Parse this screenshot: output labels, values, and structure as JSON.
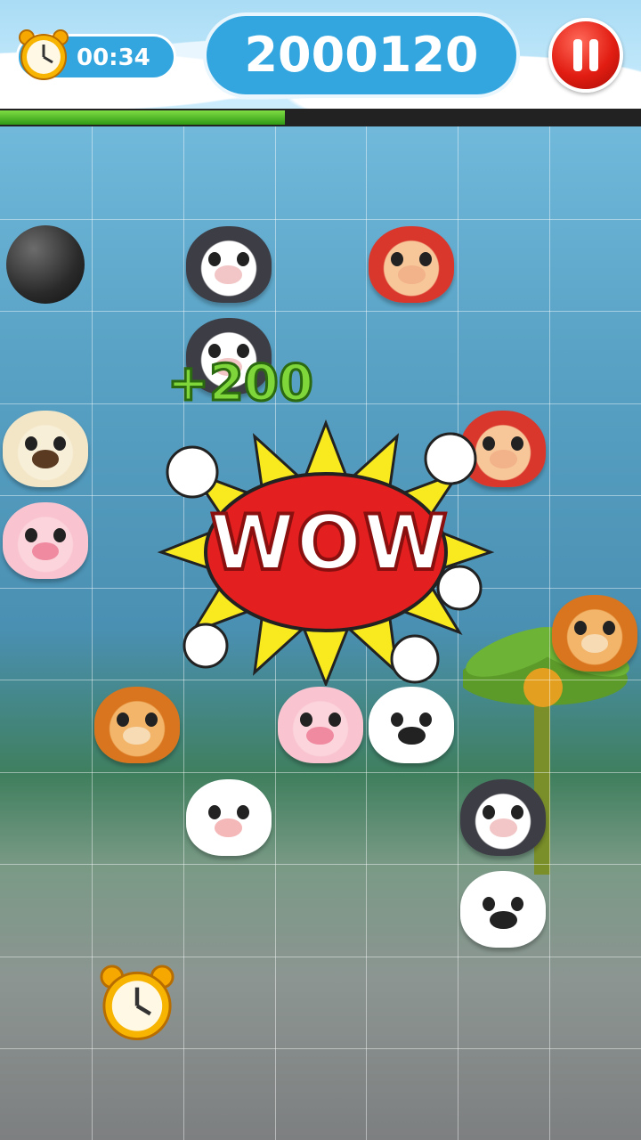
{
  "hud": {
    "timer": "00:34",
    "score": "2000120",
    "timer_icon": "alarm-clock-icon",
    "pause_icon": "pause-icon"
  },
  "progress": {
    "fraction": 0.445
  },
  "popup": {
    "points": "+200",
    "combo_text": "WOW"
  },
  "colors": {
    "hud_blue": "#34a6df",
    "pause_red": "#e21d12",
    "progress_green": "#3fae1c"
  },
  "board": {
    "cols": 7,
    "rows": 11,
    "pieces": [
      {
        "row": 1,
        "col": 0,
        "type": "bomb"
      },
      {
        "row": 1,
        "col": 2,
        "type": "cat"
      },
      {
        "row": 1,
        "col": 4,
        "type": "monkey"
      },
      {
        "row": 2,
        "col": 2,
        "type": "cat"
      },
      {
        "row": 3,
        "col": 0,
        "type": "dog"
      },
      {
        "row": 3,
        "col": 5,
        "type": "monkey"
      },
      {
        "row": 4,
        "col": 0,
        "type": "pig"
      },
      {
        "row": 5,
        "col": 6,
        "type": "bear"
      },
      {
        "row": 6,
        "col": 1,
        "type": "bear"
      },
      {
        "row": 6,
        "col": 3,
        "type": "pig"
      },
      {
        "row": 6,
        "col": 4,
        "type": "panda"
      },
      {
        "row": 7,
        "col": 2,
        "type": "cow"
      },
      {
        "row": 7,
        "col": 5,
        "type": "cat"
      },
      {
        "row": 8,
        "col": 5,
        "type": "panda"
      },
      {
        "row": 9,
        "col": 1,
        "type": "alarm-clock"
      }
    ]
  }
}
